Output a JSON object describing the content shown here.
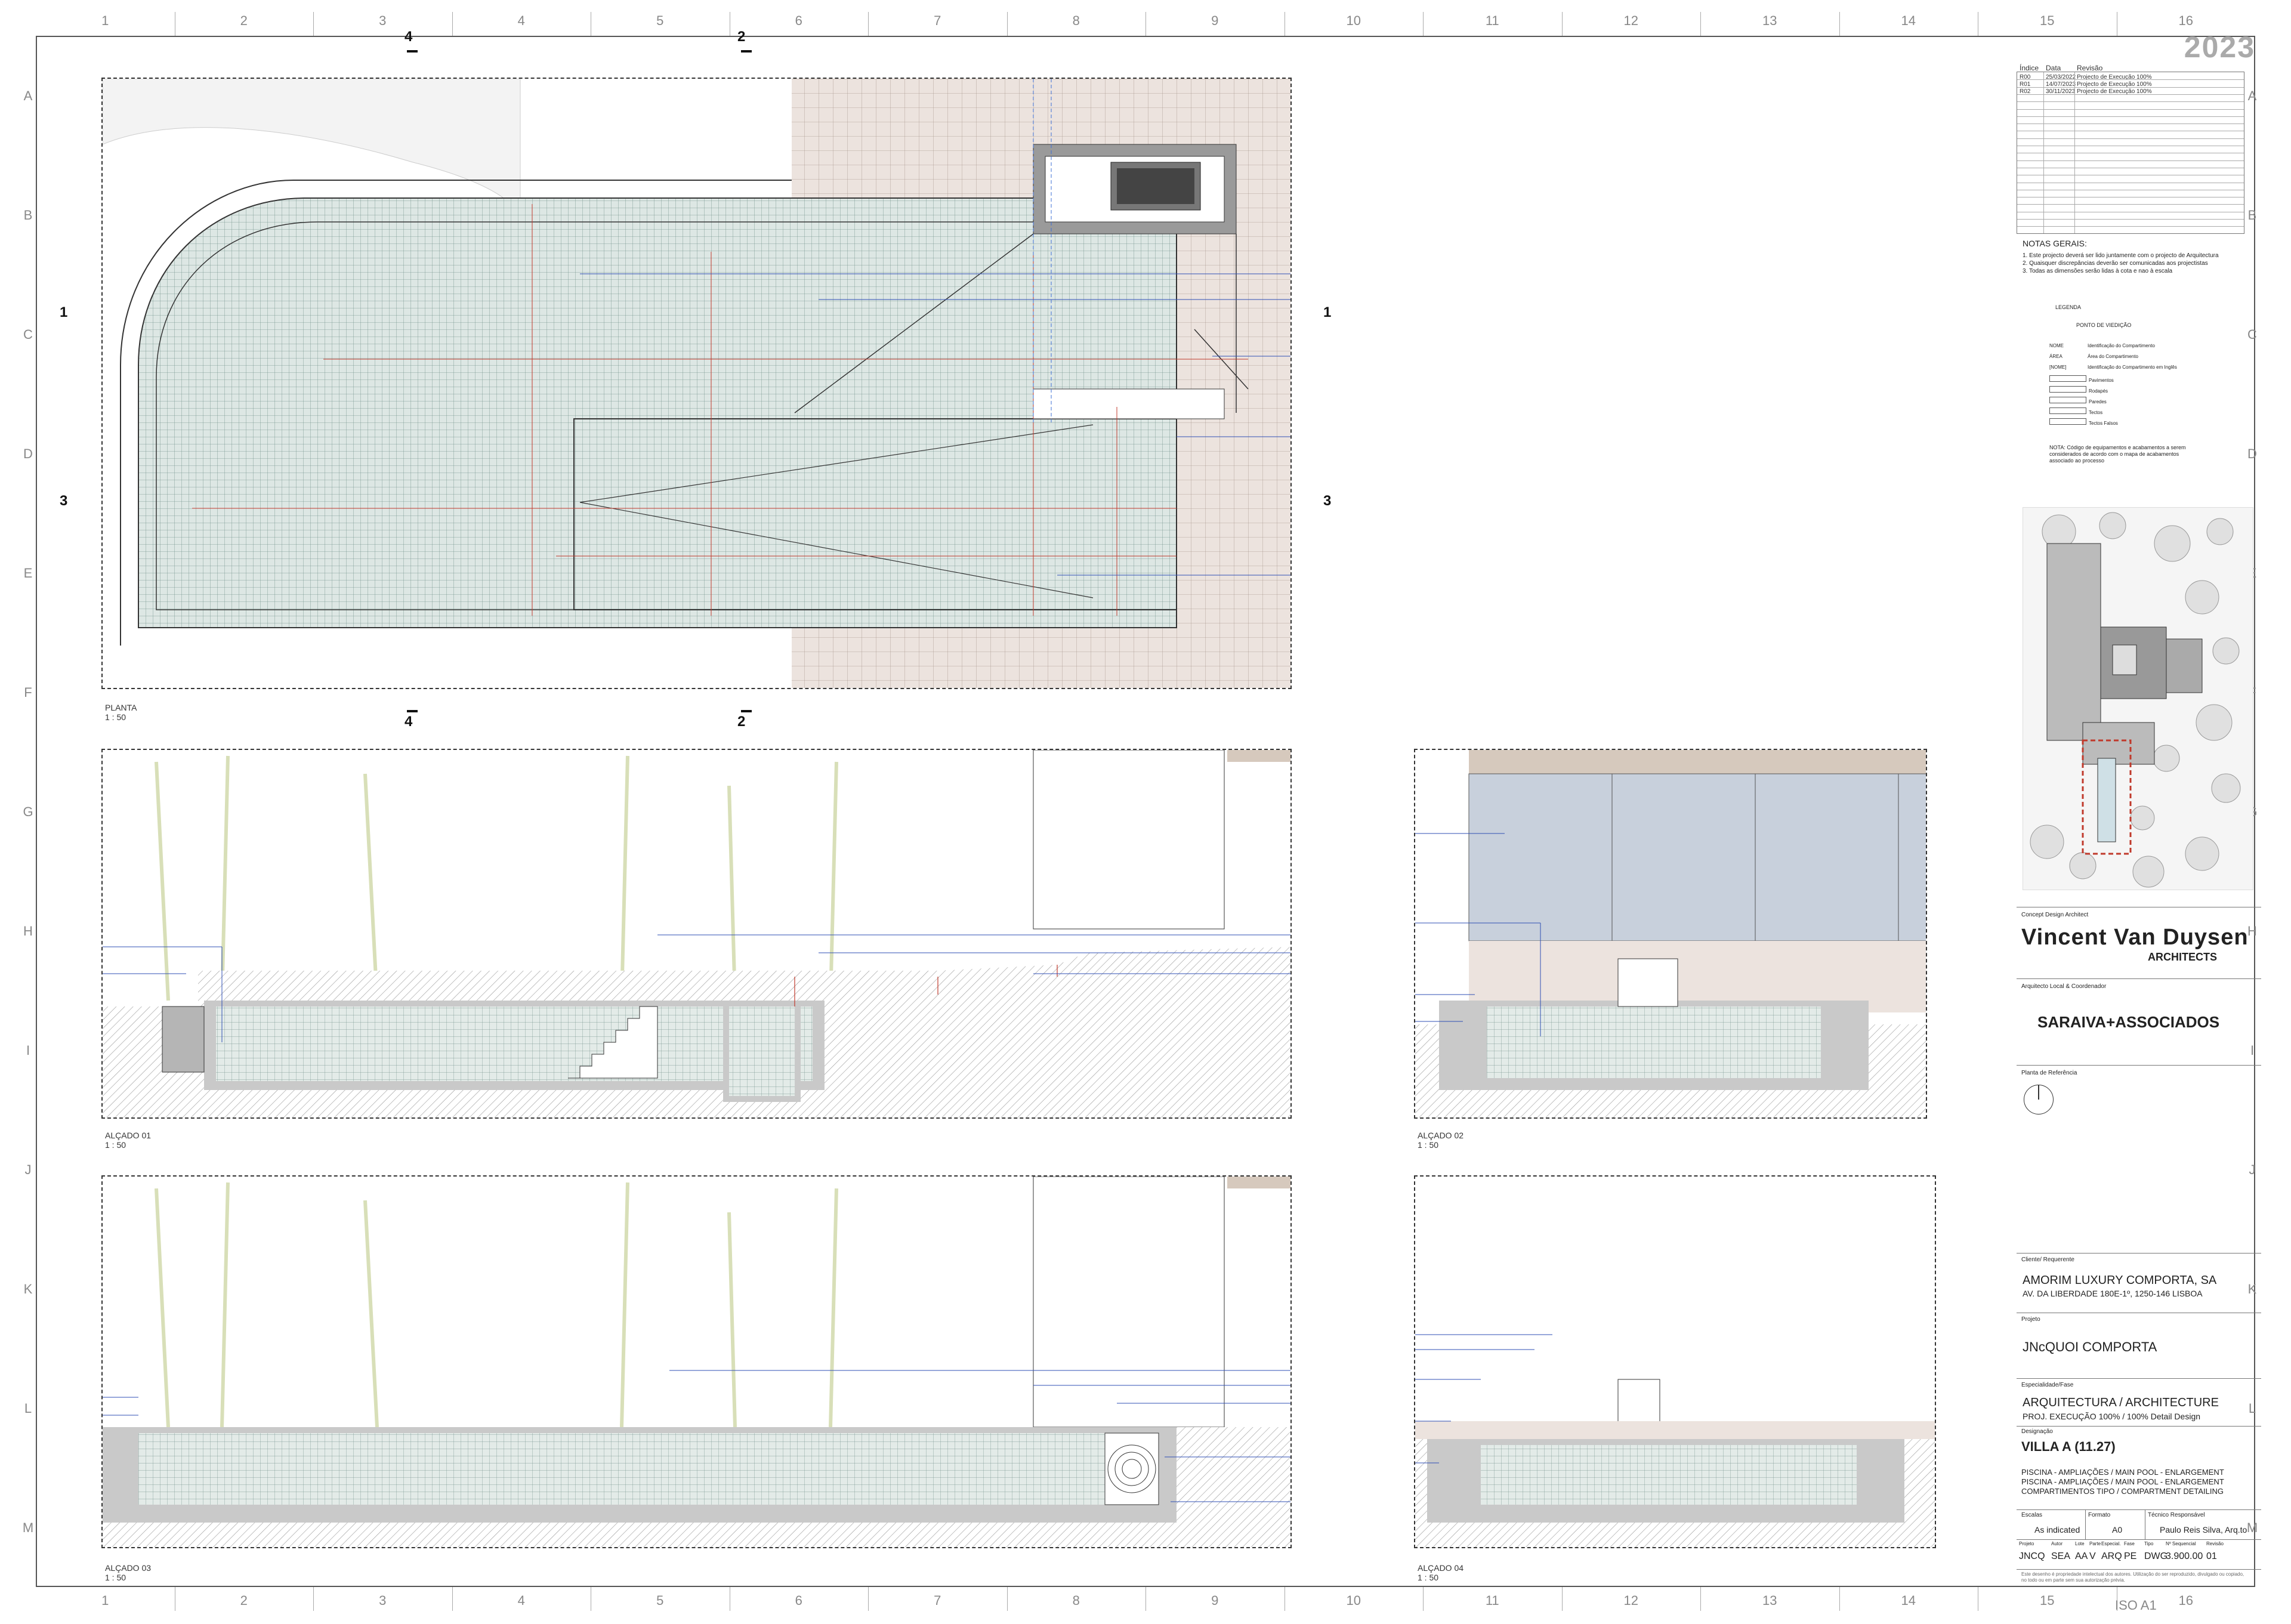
{
  "grid": {
    "columns": [
      "1",
      "2",
      "3",
      "4",
      "5",
      "6",
      "7",
      "8",
      "9",
      "10",
      "11",
      "12",
      "13",
      "14",
      "15",
      "16"
    ],
    "rows": [
      "A",
      "B",
      "C",
      "D",
      "E",
      "F",
      "G",
      "H",
      "I",
      "J",
      "K",
      "L",
      "M"
    ]
  },
  "year": "2023",
  "revisions": {
    "headers": [
      "Índice",
      "Data",
      "Revisão"
    ],
    "rows": [
      [
        "R00",
        "25/03/2022",
        "Projecto de Execução 100%"
      ],
      [
        "R01",
        "14/07/2023",
        "Projecto de Execução 100%"
      ],
      [
        "R02",
        "30/11/2023",
        "Projecto de Execução 100%"
      ]
    ]
  },
  "notes": {
    "title": "NOTAS GERAIS:",
    "items": [
      "1. Este projecto deverá ser lido juntamente com o projecto de Arquitectura",
      "2. Quaisquer discrepâncias deverão ser comunicadas aos projectistas",
      "3. Todas as dimensões serão lidas à cota e nao à escala"
    ]
  },
  "legend": {
    "title": "LEGENDA",
    "point_label": "PONTO DE VIEDIÇÃO",
    "rows": [
      [
        "NOME",
        "Identificação do Compartimento"
      ],
      [
        "ÁREA",
        "Área do Compartimento"
      ],
      [
        "[NOME]",
        "Identificação do Compartimento em Inglês"
      ],
      [
        "",
        "Pavimentos"
      ],
      [
        "",
        "Rodapés"
      ],
      [
        "",
        "Paredes"
      ],
      [
        "",
        "Tectos"
      ],
      [
        "",
        "Tectos Falsos"
      ]
    ],
    "note": "NOTA: Código de equipamentos e acabamentos a serem considerados de acordo com o mapa de acabamentos associado ao processo"
  },
  "titleblock": {
    "concept_label": "Concept Design Architect",
    "firm_main": "Vincent Van Duysen",
    "firm_sub": "ARCHITECTS",
    "local_label": "Arquitecto Local & Coordenador",
    "local_firm": "SARAIVA+ASSOCIADOS",
    "north_label": "Planta de Referência",
    "client_label": "Cliente/ Requerente",
    "client_name": "AMORIM LUXURY COMPORTA, SA",
    "client_address": "AV. DA LIBERDADE 180E-1º, 1250-146 LISBOA",
    "project_label": "Projeto",
    "project_name": "JNcQUOI COMPORTA",
    "speciality_label": "Especialidade/Fase",
    "speciality": "ARQUITECTURA / ARCHITECTURE",
    "phase": "PROJ. EXECUÇÃO 100% / 100% Detail Design",
    "designation_label": "Designação",
    "villa": "VILLA A (11.27)",
    "desc1": "PISCINA - AMPLIAÇÕES / MAIN POOL - ENLARGEMENT",
    "desc2": "PISCINA - AMPLIAÇÕES / MAIN POOL - ENLARGEMENT",
    "desc3": "COMPARTIMENTOS TIPO / COMPARTMENT DETAILING",
    "scale_label": "Escalas",
    "scale": "As indicated",
    "format_label": "Formato",
    "format": "A0",
    "tech_label": "Técnico Responsável",
    "tech": "Paulo Reis Silva, Arq.to",
    "code_headers": [
      "Projeto",
      "Autor",
      "Lote",
      "Parte",
      "Especial.",
      "Fase",
      "Tipo",
      "Nº Sequencial",
      "Revisão"
    ],
    "code_values": [
      "JNCQ",
      "SEA",
      "AA",
      "V",
      "ARQ",
      "PE",
      "DWG",
      "3.900.00",
      "01"
    ],
    "footer_note": "Este desenho é propriedade intelectual dos autores. Utilização do ser reproduzido, divulgado ou copiado, no todo ou em parte sem sua autorização prévia."
  },
  "views": {
    "plan": {
      "name": "PLANTA",
      "scale": "1 : 50"
    },
    "elev1": {
      "name": "ALÇADO 01",
      "scale": "1 : 50"
    },
    "elev2": {
      "name": "ALÇADO 02",
      "scale": "1 : 50"
    },
    "elev3": {
      "name": "ALÇADO 03",
      "scale": "1 : 50"
    },
    "elev4": {
      "name": "ALÇADO 04",
      "scale": "1 : 50"
    }
  },
  "section_marks": [
    "4",
    "2",
    "1",
    "3"
  ],
  "iso": "ISO A1",
  "colors": {
    "water": "#d9e4e1",
    "paving": "#ebe2dd",
    "concrete": "#c9c9c9",
    "dim_red": "#c0392b",
    "leader_blue": "#2f4fb5",
    "glass": "#c8d0dc",
    "deck": "#d6c9bd"
  }
}
